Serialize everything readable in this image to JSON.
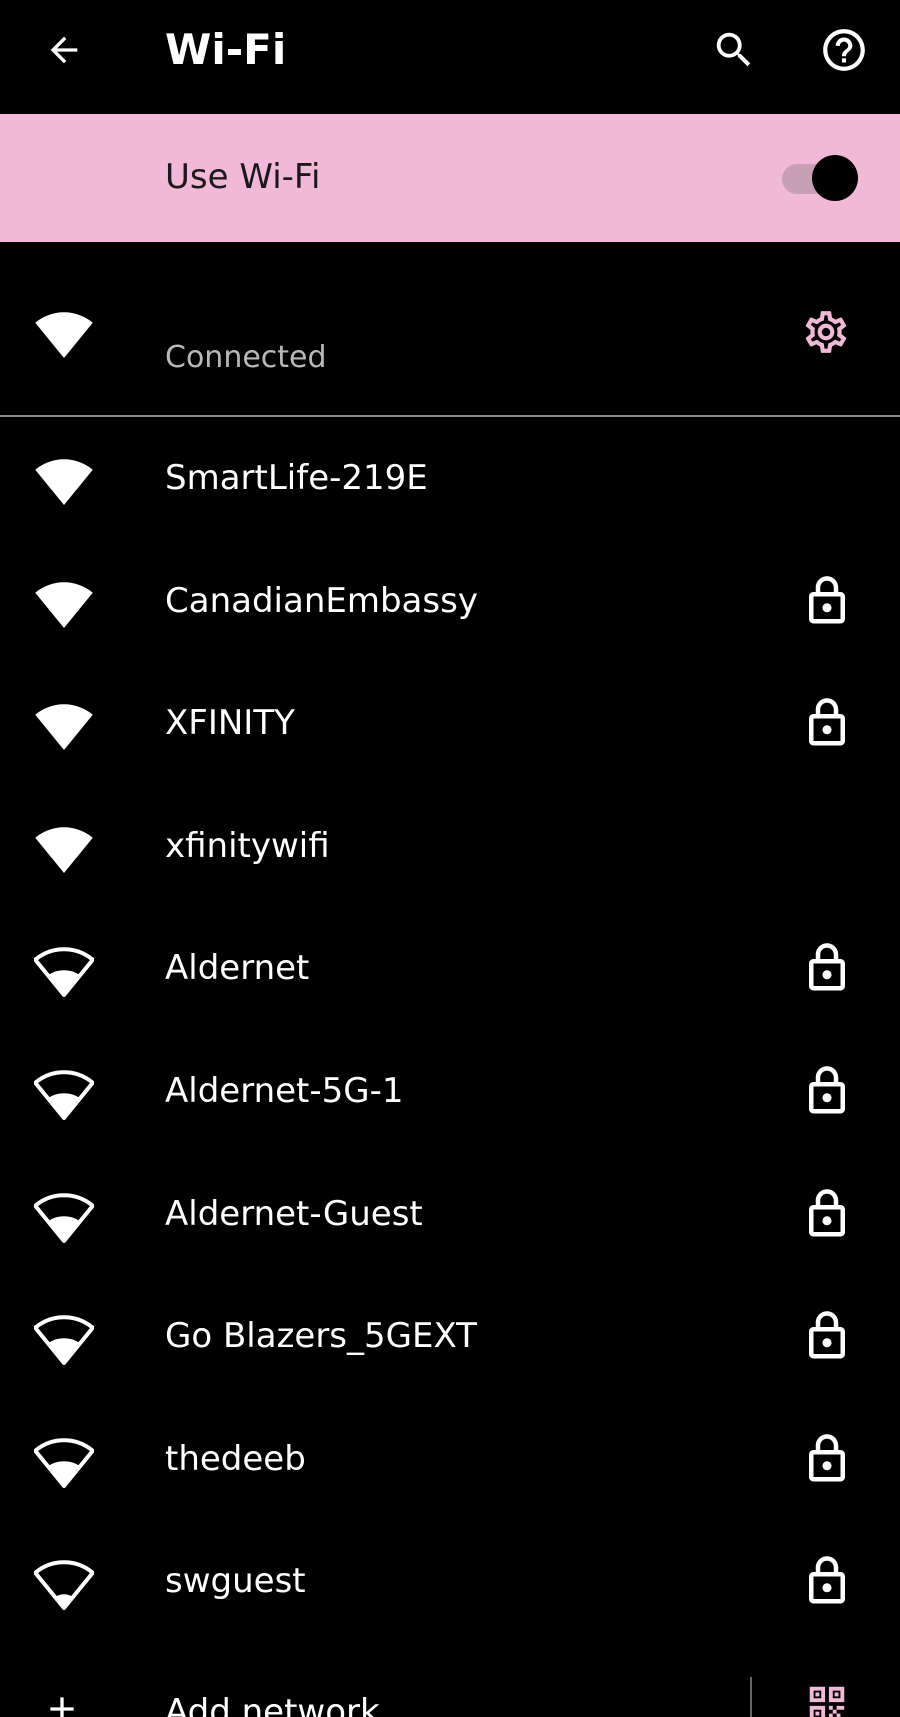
{
  "app_bar": {
    "title": "Wi-Fi",
    "back_icon": "arrow-back-icon",
    "search_icon": "search-icon",
    "help_icon": "help-circle-icon"
  },
  "master_toggle": {
    "label": "Use Wi-Fi",
    "enabled": true,
    "banner_color": "#f2b8d8"
  },
  "connected_network": {
    "status": "Connected",
    "icon": "wifi-full-icon",
    "settings_icon": "gear-icon",
    "accent_color": "#f2b8d8"
  },
  "networks": [
    {
      "name": "SmartLife-219E",
      "secured": false,
      "signal": "full"
    },
    {
      "name": "CanadianEmbassy",
      "secured": true,
      "signal": "full"
    },
    {
      "name": "XFINITY",
      "secured": true,
      "signal": "full"
    },
    {
      "name": "xfinitywifi",
      "secured": false,
      "signal": "full"
    },
    {
      "name": "Aldernet",
      "secured": true,
      "signal": "medium"
    },
    {
      "name": "Aldernet-5G-1",
      "secured": true,
      "signal": "medium"
    },
    {
      "name": "Aldernet-Guest",
      "secured": true,
      "signal": "medium"
    },
    {
      "name": "Go Blazers_5GEXT",
      "secured": true,
      "signal": "medium"
    },
    {
      "name": "thedeeb",
      "secured": true,
      "signal": "medium"
    },
    {
      "name": "swguest",
      "secured": true,
      "signal": "low"
    }
  ],
  "add_network": {
    "label": "Add network",
    "plus_icon": "plus-icon",
    "qr_icon": "qr-code-scan-icon"
  }
}
